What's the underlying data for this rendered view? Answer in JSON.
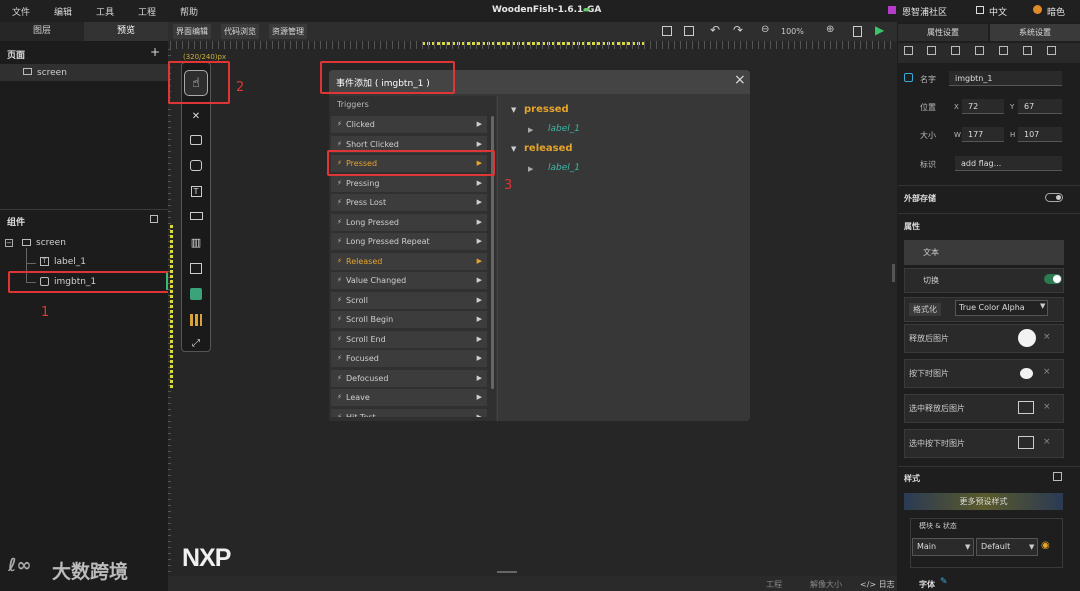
{
  "menu": [
    "文件",
    "编辑",
    "工具",
    "工程",
    "帮助"
  ],
  "app_title": "WoodenFish-1.6.1-GA",
  "topright": {
    "community": "恩智浦社区",
    "lang": "中文",
    "theme": "暗色"
  },
  "left_tabs": {
    "layers": "图层",
    "preview": "预览"
  },
  "pages": {
    "header": "页面",
    "add": "+",
    "screen": "screen"
  },
  "components": {
    "header": "组件",
    "screen": "screen",
    "label": "label_1",
    "imgbtn": "imgbtn_1"
  },
  "center_tabs": [
    "界面编辑",
    "代码浏览",
    "资源管理"
  ],
  "zoom": "100%",
  "canvas_label": "(320/240)px",
  "dialog": {
    "title": "事件添加 ( imgbtn_1 )",
    "close": "×",
    "triggers_header": "Triggers",
    "triggers": [
      "Clicked",
      "Short Clicked",
      "Pressed",
      "Pressing",
      "Press Lost",
      "Long Pressed",
      "Long Pressed Repeat",
      "Released",
      "Value Changed",
      "Scroll",
      "Scroll Begin",
      "Scroll End",
      "Focused",
      "Defocused",
      "Leave",
      "Hit Test"
    ],
    "events": [
      {
        "name": "pressed",
        "target": "label_1"
      },
      {
        "name": "released",
        "target": "label_1"
      }
    ]
  },
  "right_tabs": {
    "props": "属性设置",
    "system": "系统设置"
  },
  "props": {
    "name_label": "名字",
    "name": "imgbtn_1",
    "pos_label": "位置",
    "x_label": "X",
    "x": "72",
    "y_label": "Y",
    "y": "67",
    "size_label": "大小",
    "w_label": "W",
    "w": "177",
    "h_label": "H",
    "h": "107",
    "flag_label": "标识",
    "flag": "add flag...",
    "ext_storage": "外部存储",
    "attr_header": "属性",
    "text": "文本",
    "toggle": "切换",
    "format_label": "格式化",
    "format_value": "True Color Alpha",
    "released_img": "释放后图片",
    "pressed_img": "按下时图片",
    "checked_released_img": "选中释放后图片",
    "checked_pressed_img": "选中按下时图片",
    "style_header": "样式",
    "more_styles": "更多预设样式",
    "block_state": "模块 & 状态",
    "main": "Main",
    "default": "Default",
    "font": "字体"
  },
  "bottom": {
    "project": "工程",
    "zoom_size": "解像大小",
    "log": "日志"
  },
  "annotations": [
    "1",
    "2",
    "3"
  ],
  "watermark": "大数跨境",
  "logo": "NXP"
}
